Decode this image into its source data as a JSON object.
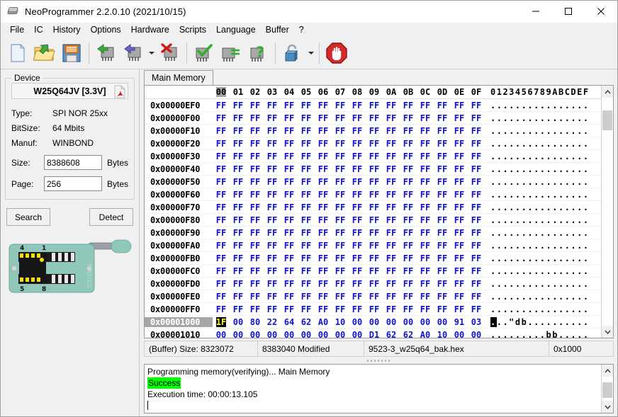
{
  "window": {
    "title": "NeoProgrammer 2.2.0.10 (2021/10/15)",
    "icon": "chip-icon",
    "minimize_label": "Minimize",
    "maximize_label": "Maximize",
    "close_label": "Close"
  },
  "menu": {
    "items": [
      {
        "id": "file",
        "label": "File"
      },
      {
        "id": "ic",
        "label": "IC"
      },
      {
        "id": "history",
        "label": "History"
      },
      {
        "id": "options",
        "label": "Options"
      },
      {
        "id": "hardware",
        "label": "Hardware"
      },
      {
        "id": "scripts",
        "label": "Scripts"
      },
      {
        "id": "language",
        "label": "Language"
      },
      {
        "id": "buffer",
        "label": "Buffer"
      },
      {
        "id": "help",
        "label": "?"
      }
    ]
  },
  "toolbar": {
    "buttons": [
      {
        "id": "new",
        "icon": "new-file-icon",
        "label": "New"
      },
      {
        "id": "open",
        "icon": "open-folder-icon",
        "label": "Open"
      },
      {
        "id": "save",
        "icon": "floppy-save-icon",
        "label": "Save"
      },
      {
        "id": "read",
        "icon": "read-chip-icon",
        "label": "Read"
      },
      {
        "id": "write",
        "icon": "write-chip-icon",
        "label": "Write"
      },
      {
        "id": "write-dropdown",
        "icon": "chevron-down-icon",
        "label": "Write options"
      },
      {
        "id": "erase",
        "icon": "erase-chip-icon",
        "label": "Erase"
      },
      {
        "id": "verify",
        "icon": "verify-chip-icon",
        "label": "Verify"
      },
      {
        "id": "blankcheck",
        "icon": "blank-check-icon",
        "label": "Blank check"
      },
      {
        "id": "chipid",
        "icon": "chip-id-icon",
        "label": "Chip ID"
      },
      {
        "id": "unlock",
        "icon": "padlock-icon",
        "label": "Unlock"
      },
      {
        "id": "unlock-dropdown",
        "icon": "chevron-down-icon",
        "label": "Unlock options"
      },
      {
        "id": "stop",
        "icon": "stop-hand-icon",
        "label": "Stop"
      }
    ]
  },
  "device": {
    "group_label": "Device",
    "name": "W25Q64JV [3.3V]",
    "datasheet_icon": "pdf-icon",
    "fields": [
      {
        "label": "Type:",
        "value": "SPI NOR  25xx"
      },
      {
        "label": "BitSize:",
        "value": "64 Mbits"
      },
      {
        "label": "Manuf:",
        "value": "WINBOND"
      }
    ],
    "size": {
      "label": "Size:",
      "value": "8388608",
      "unit": "Bytes"
    },
    "page": {
      "label": "Page:",
      "value": "256",
      "unit": "Bytes"
    },
    "search_button": "Search",
    "detect_button": "Detect",
    "socket": {
      "brand": "TEXTOOL",
      "pins": [
        "4",
        "1",
        "5",
        "8"
      ]
    }
  },
  "main": {
    "tabs": [
      {
        "id": "main-memory",
        "label": "Main Memory",
        "active": true
      }
    ]
  },
  "hex": {
    "column_headers": [
      "00",
      "01",
      "02",
      "03",
      "04",
      "05",
      "06",
      "07",
      "08",
      "09",
      "0A",
      "0B",
      "0C",
      "0D",
      "0E",
      "0F"
    ],
    "ascii_header": "0123456789ABCDEF",
    "cursor_column": 0,
    "rows": [
      {
        "addr": "0x00000EF0",
        "bytes": [
          "FF",
          "FF",
          "FF",
          "FF",
          "FF",
          "FF",
          "FF",
          "FF",
          "FF",
          "FF",
          "FF",
          "FF",
          "FF",
          "FF",
          "FF",
          "FF"
        ],
        "ascii": "................",
        "selected": false
      },
      {
        "addr": "0x00000F00",
        "bytes": [
          "FF",
          "FF",
          "FF",
          "FF",
          "FF",
          "FF",
          "FF",
          "FF",
          "FF",
          "FF",
          "FF",
          "FF",
          "FF",
          "FF",
          "FF",
          "FF"
        ],
        "ascii": "................",
        "selected": false
      },
      {
        "addr": "0x00000F10",
        "bytes": [
          "FF",
          "FF",
          "FF",
          "FF",
          "FF",
          "FF",
          "FF",
          "FF",
          "FF",
          "FF",
          "FF",
          "FF",
          "FF",
          "FF",
          "FF",
          "FF"
        ],
        "ascii": "................",
        "selected": false
      },
      {
        "addr": "0x00000F20",
        "bytes": [
          "FF",
          "FF",
          "FF",
          "FF",
          "FF",
          "FF",
          "FF",
          "FF",
          "FF",
          "FF",
          "FF",
          "FF",
          "FF",
          "FF",
          "FF",
          "FF"
        ],
        "ascii": "................",
        "selected": false
      },
      {
        "addr": "0x00000F30",
        "bytes": [
          "FF",
          "FF",
          "FF",
          "FF",
          "FF",
          "FF",
          "FF",
          "FF",
          "FF",
          "FF",
          "FF",
          "FF",
          "FF",
          "FF",
          "FF",
          "FF"
        ],
        "ascii": "................",
        "selected": false
      },
      {
        "addr": "0x00000F40",
        "bytes": [
          "FF",
          "FF",
          "FF",
          "FF",
          "FF",
          "FF",
          "FF",
          "FF",
          "FF",
          "FF",
          "FF",
          "FF",
          "FF",
          "FF",
          "FF",
          "FF"
        ],
        "ascii": "................",
        "selected": false
      },
      {
        "addr": "0x00000F50",
        "bytes": [
          "FF",
          "FF",
          "FF",
          "FF",
          "FF",
          "FF",
          "FF",
          "FF",
          "FF",
          "FF",
          "FF",
          "FF",
          "FF",
          "FF",
          "FF",
          "FF"
        ],
        "ascii": "................",
        "selected": false
      },
      {
        "addr": "0x00000F60",
        "bytes": [
          "FF",
          "FF",
          "FF",
          "FF",
          "FF",
          "FF",
          "FF",
          "FF",
          "FF",
          "FF",
          "FF",
          "FF",
          "FF",
          "FF",
          "FF",
          "FF"
        ],
        "ascii": "................",
        "selected": false
      },
      {
        "addr": "0x00000F70",
        "bytes": [
          "FF",
          "FF",
          "FF",
          "FF",
          "FF",
          "FF",
          "FF",
          "FF",
          "FF",
          "FF",
          "FF",
          "FF",
          "FF",
          "FF",
          "FF",
          "FF"
        ],
        "ascii": "................",
        "selected": false
      },
      {
        "addr": "0x00000F80",
        "bytes": [
          "FF",
          "FF",
          "FF",
          "FF",
          "FF",
          "FF",
          "FF",
          "FF",
          "FF",
          "FF",
          "FF",
          "FF",
          "FF",
          "FF",
          "FF",
          "FF"
        ],
        "ascii": "................",
        "selected": false
      },
      {
        "addr": "0x00000F90",
        "bytes": [
          "FF",
          "FF",
          "FF",
          "FF",
          "FF",
          "FF",
          "FF",
          "FF",
          "FF",
          "FF",
          "FF",
          "FF",
          "FF",
          "FF",
          "FF",
          "FF"
        ],
        "ascii": "................",
        "selected": false
      },
      {
        "addr": "0x00000FA0",
        "bytes": [
          "FF",
          "FF",
          "FF",
          "FF",
          "FF",
          "FF",
          "FF",
          "FF",
          "FF",
          "FF",
          "FF",
          "FF",
          "FF",
          "FF",
          "FF",
          "FF"
        ],
        "ascii": "................",
        "selected": false
      },
      {
        "addr": "0x00000FB0",
        "bytes": [
          "FF",
          "FF",
          "FF",
          "FF",
          "FF",
          "FF",
          "FF",
          "FF",
          "FF",
          "FF",
          "FF",
          "FF",
          "FF",
          "FF",
          "FF",
          "FF"
        ],
        "ascii": "................",
        "selected": false
      },
      {
        "addr": "0x00000FC0",
        "bytes": [
          "FF",
          "FF",
          "FF",
          "FF",
          "FF",
          "FF",
          "FF",
          "FF",
          "FF",
          "FF",
          "FF",
          "FF",
          "FF",
          "FF",
          "FF",
          "FF"
        ],
        "ascii": "................",
        "selected": false
      },
      {
        "addr": "0x00000FD0",
        "bytes": [
          "FF",
          "FF",
          "FF",
          "FF",
          "FF",
          "FF",
          "FF",
          "FF",
          "FF",
          "FF",
          "FF",
          "FF",
          "FF",
          "FF",
          "FF",
          "FF"
        ],
        "ascii": "................",
        "selected": false
      },
      {
        "addr": "0x00000FE0",
        "bytes": [
          "FF",
          "FF",
          "FF",
          "FF",
          "FF",
          "FF",
          "FF",
          "FF",
          "FF",
          "FF",
          "FF",
          "FF",
          "FF",
          "FF",
          "FF",
          "FF"
        ],
        "ascii": "................",
        "selected": false
      },
      {
        "addr": "0x00000FF0",
        "bytes": [
          "FF",
          "FF",
          "FF",
          "FF",
          "FF",
          "FF",
          "FF",
          "FF",
          "FF",
          "FF",
          "FF",
          "FF",
          "FF",
          "FF",
          "FF",
          "FF"
        ],
        "ascii": "................",
        "selected": false
      },
      {
        "addr": "0x00001000",
        "bytes": [
          "1F",
          "00",
          "80",
          "22",
          "64",
          "62",
          "A0",
          "10",
          "00",
          "00",
          "00",
          "00",
          "00",
          "00",
          "91",
          "03"
        ],
        "ascii": "...\"db..........",
        "selected": true,
        "cursor_byte": 0,
        "cursor_ascii": 0
      },
      {
        "addr": "0x00001010",
        "bytes": [
          "00",
          "00",
          "00",
          "00",
          "00",
          "00",
          "00",
          "00",
          "00",
          "D1",
          "62",
          "62",
          "A0",
          "10",
          "00",
          "00"
        ],
        "ascii": ".........bb.....",
        "selected": false
      }
    ]
  },
  "statusbar": {
    "buffer_size": "(Buffer) Size: 8323072",
    "modified": "8383040 Modified",
    "filename": "9523-3_w25q64_bak.hex",
    "offset": "0x1000"
  },
  "log": {
    "line1": "Programming memory(verifying)... Main Memory",
    "line2": "Success",
    "line3": "Execution time: 00:00:13.105"
  },
  "colors": {
    "hex_byte": "#1010cf",
    "selection_gray": "#a6a6a6",
    "cursor_bg": "#000000",
    "cursor_fg": "#ffff00",
    "success_bg": "#00ff00",
    "socket_body": "#8fc7bb"
  }
}
